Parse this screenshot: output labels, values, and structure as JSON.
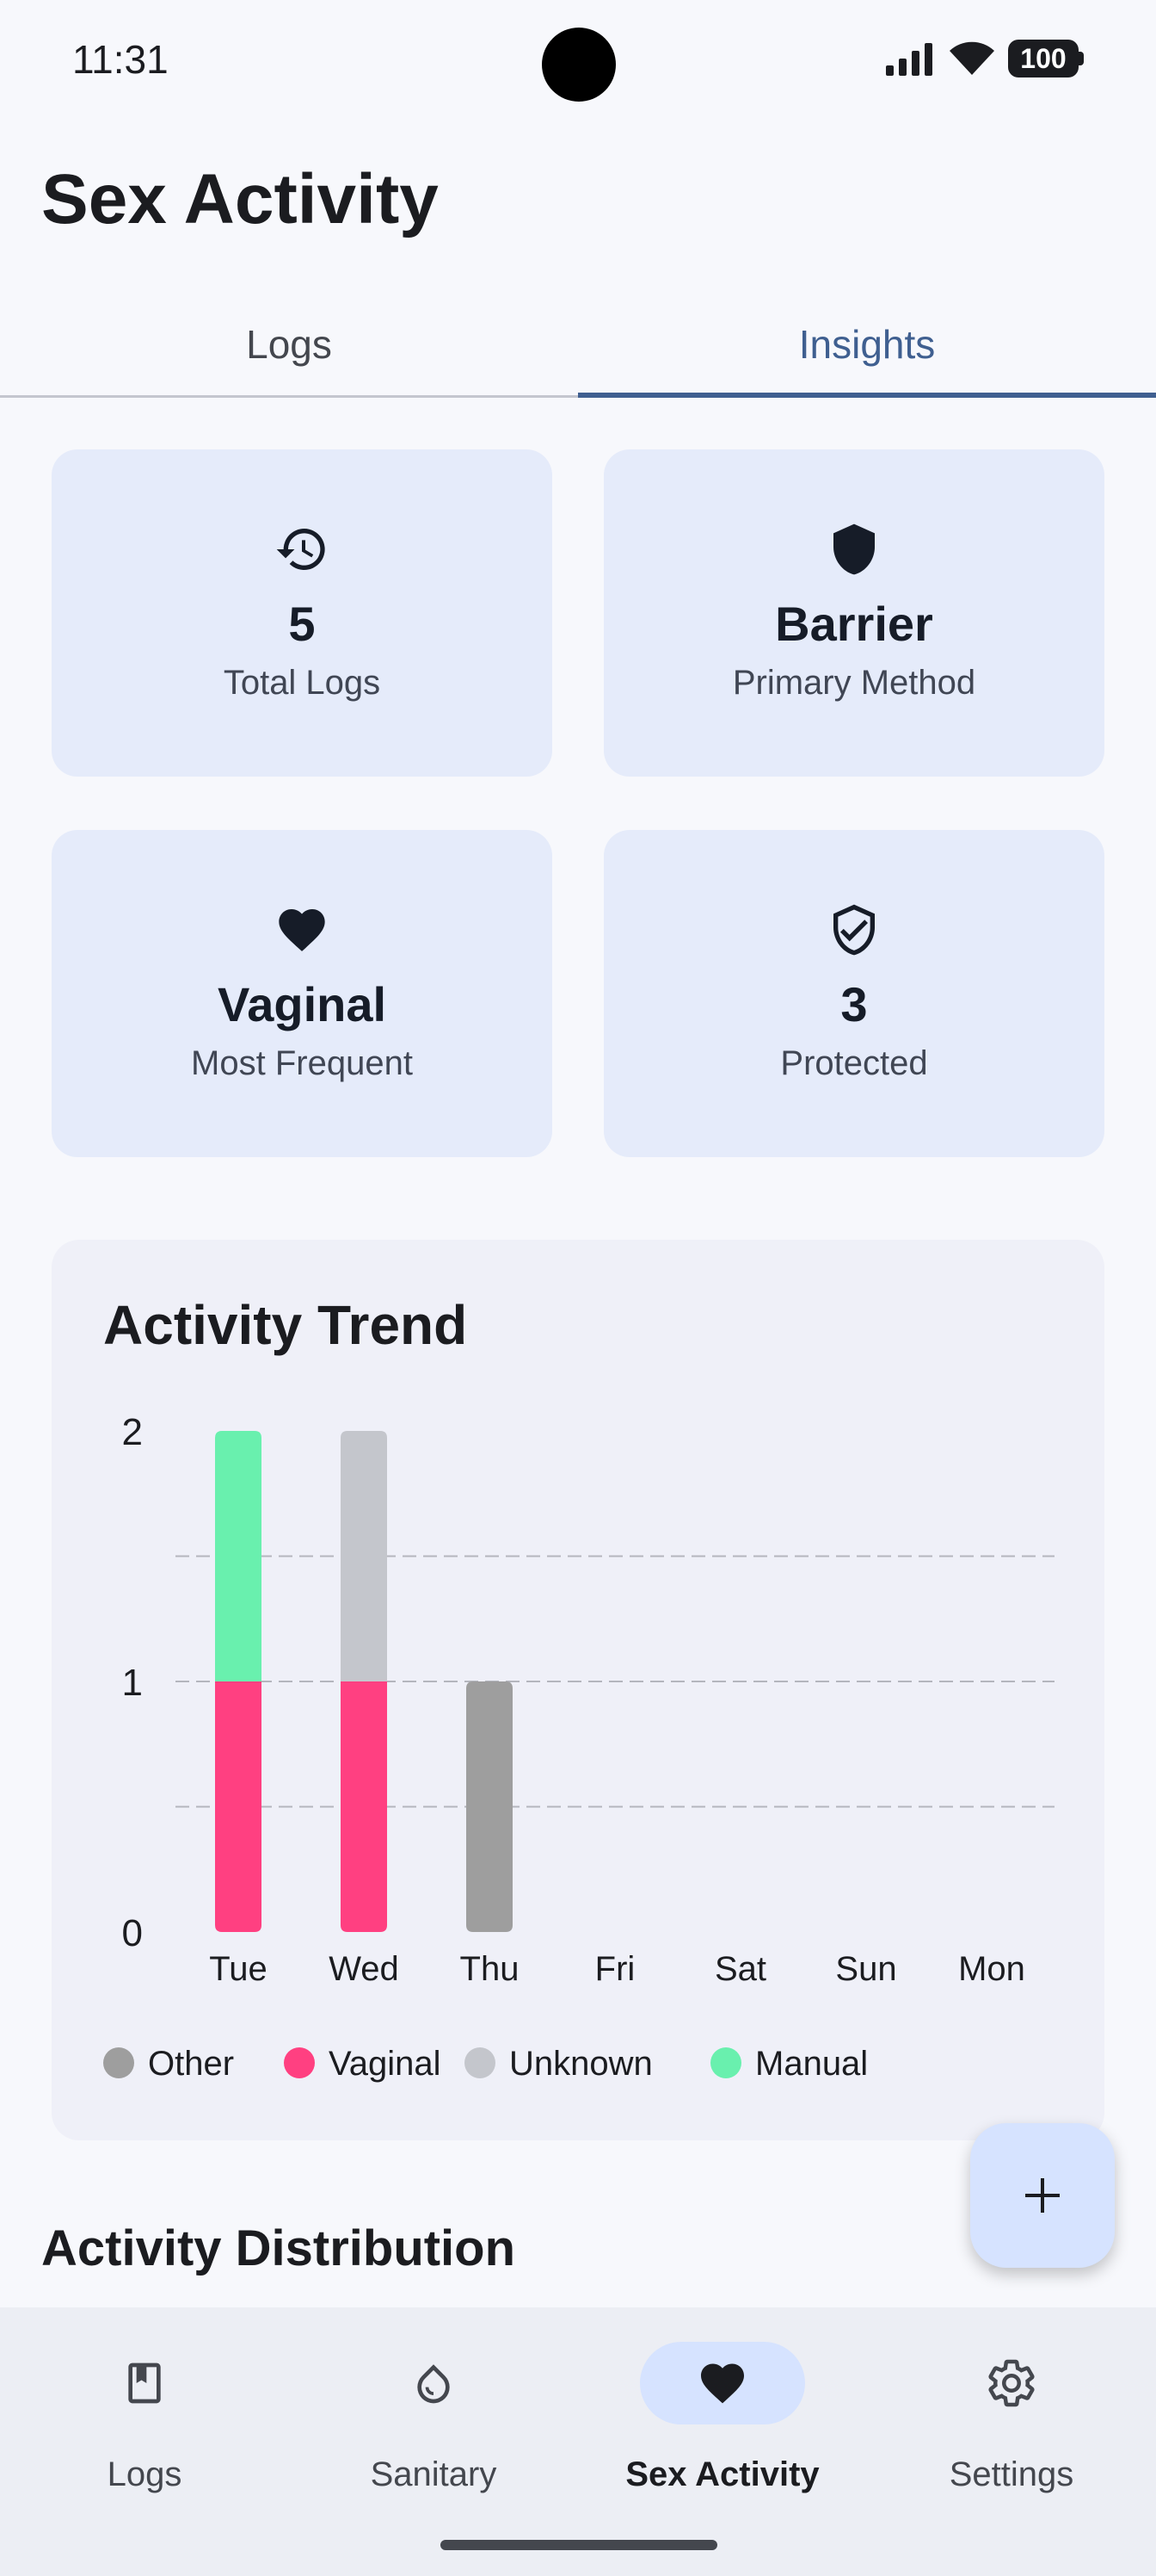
{
  "status_bar": {
    "time": "11:31",
    "battery": "100"
  },
  "page_title": "Sex Activity",
  "tabs": [
    {
      "label": "Logs",
      "active": false
    },
    {
      "label": "Insights",
      "active": true
    }
  ],
  "stats": [
    {
      "icon": "history-icon",
      "value": "5",
      "label": "Total Logs"
    },
    {
      "icon": "shield-icon",
      "value": "Barrier",
      "label": "Primary Method"
    },
    {
      "icon": "heart-icon",
      "value": "Vaginal",
      "label": "Most Frequent"
    },
    {
      "icon": "shield-check-icon",
      "value": "3",
      "label": "Protected"
    }
  ],
  "chart_title": "Activity Trend",
  "chart_data": {
    "type": "bar",
    "stacked": true,
    "categories": [
      "Tue",
      "Wed",
      "Thu",
      "Fri",
      "Sat",
      "Sun",
      "Mon"
    ],
    "y_ticks": [
      "0",
      "1",
      "2"
    ],
    "ylim": [
      0,
      2
    ],
    "grid": true,
    "legend_position": "bottom",
    "series": [
      {
        "name": "Other",
        "color": "#9e9e9e",
        "values": [
          0,
          0,
          1,
          0,
          0,
          0,
          0
        ]
      },
      {
        "name": "Vaginal",
        "color": "#ff4081",
        "values": [
          1,
          1,
          0,
          0,
          0,
          0,
          0
        ]
      },
      {
        "name": "Unknown",
        "color": "#c4c6cc",
        "values": [
          0,
          1,
          0,
          0,
          0,
          0,
          0
        ]
      },
      {
        "name": "Manual",
        "color": "#69f0ae",
        "values": [
          1,
          0,
          0,
          0,
          0,
          0,
          0
        ]
      }
    ]
  },
  "distribution_heading": "Activity Distribution",
  "fab_icon": "plus-icon",
  "bottom_nav": [
    {
      "label": "Logs",
      "icon": "bookmark-book-icon",
      "active": false
    },
    {
      "label": "Sanitary",
      "icon": "drop-icon",
      "active": false
    },
    {
      "label": "Sex Activity",
      "icon": "heart-icon",
      "active": true
    },
    {
      "label": "Settings",
      "icon": "gear-icon",
      "active": false
    }
  ],
  "colors": {
    "accent": "#3f5f90",
    "card_bg": "#e5ebfa",
    "nav_pill": "#d6e3ff"
  }
}
